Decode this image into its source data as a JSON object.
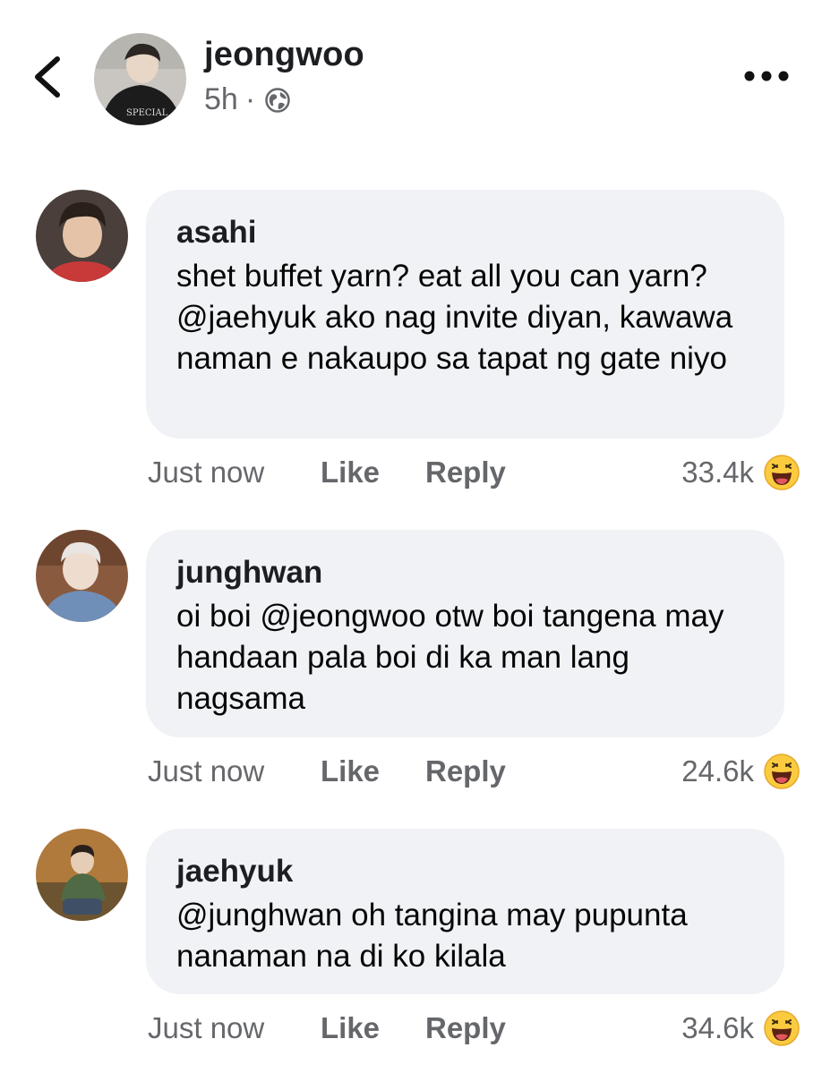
{
  "header": {
    "back_icon": "chevron-left-icon",
    "poster_name": "jeongwoo",
    "time_ago": "5h",
    "separator": "·",
    "privacy_icon": "globe-icon",
    "more_icon": "more-dots-icon"
  },
  "comments": [
    {
      "author": "asahi",
      "text": "shet buffet yarn? eat all you can yarn? @jaehyuk ako nag invite diyan, kawawa naman e nakaupo sa tapat ng gate niyo",
      "time": "Just now",
      "like_label": "Like",
      "reply_label": "Reply",
      "reaction_count": "33.4k",
      "reaction_icon": "haha-emoji-icon"
    },
    {
      "author": "junghwan",
      "text": "oi boi @jeongwoo otw boi tangena may handaan pala boi di ka man lang nagsama",
      "time": "Just now",
      "like_label": "Like",
      "reply_label": "Reply",
      "reaction_count": "24.6k",
      "reaction_icon": "haha-emoji-icon"
    },
    {
      "author": "jaehyuk",
      "text": "@junghwan oh tangina may pupunta nanaman na di ko kilala",
      "time": "Just now",
      "like_label": "Like",
      "reply_label": "Reply",
      "reaction_count": "34.6k",
      "reaction_icon": "haha-emoji-icon"
    }
  ],
  "colors": {
    "bubble_bg": "#f0f2f5",
    "secondary_text": "#65676b",
    "primary_text": "#050505",
    "emoji_yellow": "#fbcb3f"
  }
}
